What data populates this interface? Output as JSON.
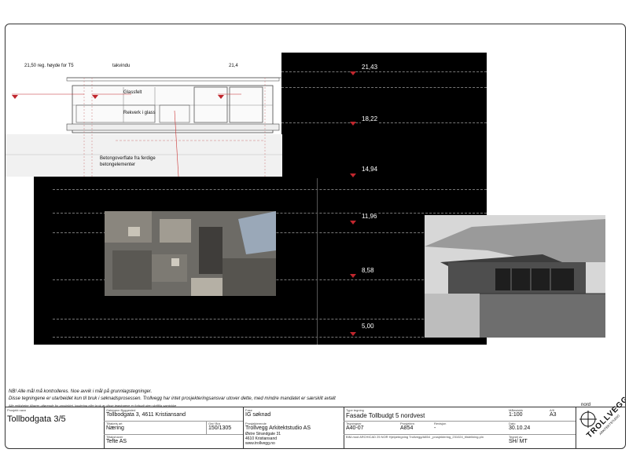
{
  "drawing": {
    "annotations": {
      "height_left": "21,50 reg. høyde for T5",
      "skylight": "takvindu",
      "height_right": "21,4",
      "glass_field": "Glassfelt",
      "railing": "Rekverk i glass",
      "concrete_line1": "Betongoverflate fra ferdige",
      "concrete_line2": "betongelementer"
    },
    "levels": [
      "21,43",
      "18,22",
      "14,94",
      "11,96",
      "8,58",
      "5,00"
    ]
  },
  "notes": {
    "line1": "NB! Alle mål må kontrolleres. Noe avvik i mål på grunnlagstegninger.",
    "line2": "Disse tegningene er utarbeidet kun til bruk i søknadsprosessen. Trollvegg har intet prosjekteringsansvar utover dette, med mindre mandatet er særskilt avtalt",
    "line3": "Alle rettigheter tilhører utførende for prosjektet, kopiering eller bruk av disse tegningene er forbudt uten skriftlig samtykke"
  },
  "title_block": {
    "project_name_label": "Prosjekt navn",
    "project_name": "Tollbodgata 3/5",
    "property_label": "Gatenavn Byggested",
    "property": "Tollbodgata 3, 4611 Kristiansand",
    "purpose_label": "Tiltakets art",
    "purpose": "Næring",
    "gnr_label": "Gnr/ Bnr",
    "gnr": "150/1305",
    "owner_label": "Tiltakshaver",
    "owner": "Tefte AS",
    "phase_label": "Fase",
    "phase": "IG søknad",
    "architect_label": "Prosjekterende",
    "architect_name": "Trollvegg Arkitektstudio AS",
    "architect_addr1": "Østre Strandgate 31",
    "architect_addr2": "4610 Kristiansand",
    "architect_web": "www.trollvegg.no",
    "drawing_type_label": "Type tegning",
    "drawing_type": "Fasade  Tollbudgt 5 nordvest",
    "drawing_no_label": "Tegningsnr.",
    "drawing_no": "A40-07",
    "project_no_label": "Prosjektnr.",
    "project_no": "A854",
    "revision_label": "Revisjon",
    "revision": "-",
    "scale_label": "Målestokk",
    "scale": "1:100",
    "format_label": "A/K",
    "format": "A3",
    "date_label": "Dato",
    "date": "30.10.24",
    "drawn_label": "Tegnet av",
    "drawn_by": "SH/ MT",
    "file_path": "BIM-mod ARCHICAD 25 NOR Hjelpetegning Trollvegg/A854 _prosjektering_231024_tilstellning.pln",
    "north_label": "nord",
    "logo_text": "TROLLVEGG",
    "logo_sub": "ARKITEKTSTUDIO"
  }
}
